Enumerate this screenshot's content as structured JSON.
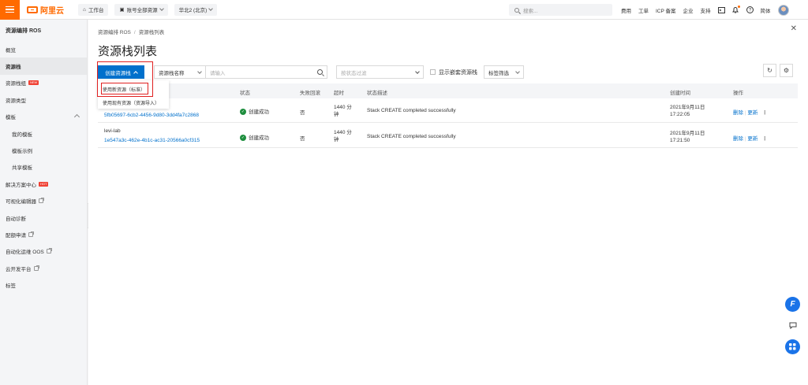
{
  "topbar": {
    "logo_text": "阿里云",
    "workbench": "工作台",
    "resource_scope": "账号全部资源",
    "region": "华北2 (北京)",
    "search_placeholder": "搜索...",
    "links": [
      "费用",
      "工单",
      "ICP 备案",
      "企业",
      "支持"
    ],
    "lang": "简体"
  },
  "sidebar": {
    "title": "资源编排 ROS",
    "items": [
      {
        "label": "概览"
      },
      {
        "label": "资源栈",
        "active": true
      },
      {
        "label": "资源栈组",
        "tag": "NEW"
      },
      {
        "label": "资源类型"
      },
      {
        "label": "模板"
      },
      {
        "label": "我的模板",
        "sub": true
      },
      {
        "label": "模板示例",
        "sub": true
      },
      {
        "label": "共享模板",
        "sub": true
      },
      {
        "label": "解决方案中心",
        "tag": "HOT"
      },
      {
        "label": "可视化编辑器",
        "external": true
      },
      {
        "label": "自动诊断"
      },
      {
        "label": "配额申请",
        "external": true
      },
      {
        "label": "自动化运维 OOS",
        "external": true
      },
      {
        "label": "云开发平台",
        "external": true
      },
      {
        "label": "标签"
      }
    ]
  },
  "main": {
    "breadcrumb": [
      "资源编排 ROS",
      "资源栈列表"
    ],
    "title": "资源栈列表",
    "toolbar": {
      "create_button": "创建资源栈",
      "filter_field": "资源栈名称",
      "search_placeholder": "请输入",
      "status_filter": "按状态过滤",
      "show_nested_label": "显示嵌套资源栈",
      "tag_filter": "标签筛选"
    },
    "dropdown": {
      "option_new": "使用新资源（标准）",
      "option_existing": "使用现有资源（资源导入）"
    },
    "columns": [
      "状态",
      "失败回滚",
      "超时",
      "状态描述",
      "创建时间",
      "操作"
    ],
    "rows": [
      {
        "name": "",
        "id": "5fb05697-6cb2-4456-9d80-3dd4fa7c2868",
        "status": "创建成功",
        "rollback": "否",
        "timeout_line1": "1440 分",
        "timeout_line2": "钟",
        "desc": "Stack CREATE completed successfully",
        "created_date": "2021年9月11日",
        "created_time": "17:22:05",
        "action_delete": "删除",
        "action_update": "更新"
      },
      {
        "name": "levi-lab",
        "id": "1e547a3c-462e-4b1c-ac31-20566a0cf315",
        "status": "创建成功",
        "rollback": "否",
        "timeout_line1": "1440 分",
        "timeout_line2": "钟",
        "desc": "Stack CREATE completed successfully",
        "created_date": "2021年9月11日",
        "created_time": "17:21:50",
        "action_delete": "删除",
        "action_update": "更新"
      }
    ]
  },
  "colors": {
    "brand": "#ff6a00",
    "primary": "#0070cc",
    "success": "#1e8e3e",
    "highlight": "#e02020"
  }
}
